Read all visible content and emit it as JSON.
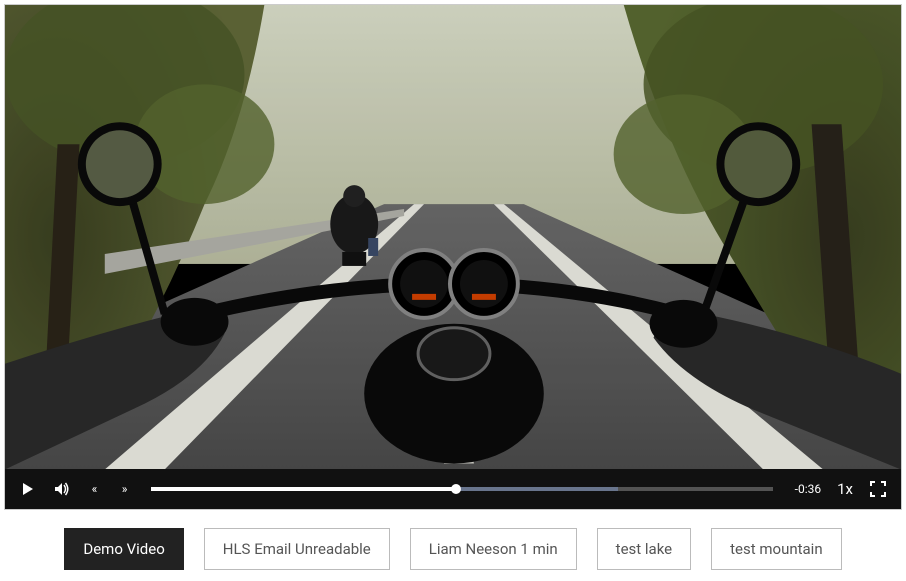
{
  "player": {
    "progress_percent": 49,
    "buffer_percent": 75,
    "remaining_time": "-0:36",
    "playback_rate": "1x",
    "icons": {
      "play": "play-icon",
      "volume": "volume-icon",
      "seek_back": "«",
      "seek_forward": "»",
      "fullscreen": "fullscreen-icon"
    }
  },
  "tabs": {
    "items": [
      {
        "label": "Demo Video",
        "active": true
      },
      {
        "label": "HLS Email Unreadable",
        "active": false
      },
      {
        "label": "Liam Neeson 1 min",
        "active": false
      },
      {
        "label": "test lake",
        "active": false
      },
      {
        "label": "test mountain",
        "active": false
      }
    ]
  }
}
